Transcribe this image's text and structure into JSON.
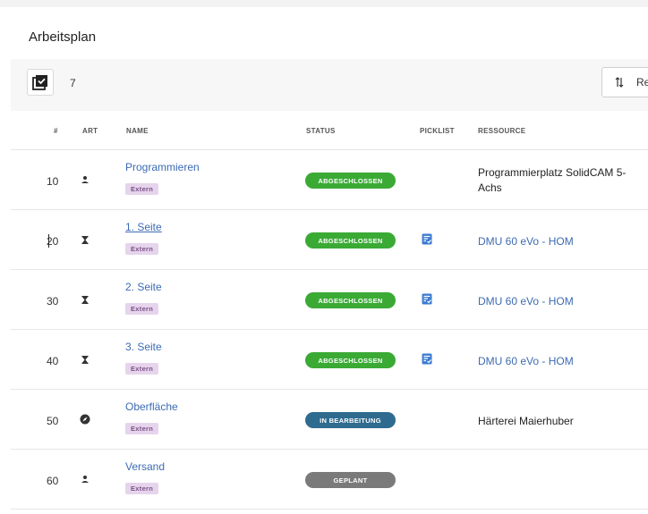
{
  "panel": {
    "title": "Arbeitsplan"
  },
  "toolbar": {
    "selected_count": "7",
    "sort_label": "Re"
  },
  "table": {
    "headers": [
      "#",
      "ART",
      "NAME",
      "STATUS",
      "PICKLIST",
      "RESSOURCE"
    ],
    "rows": [
      {
        "num": "10",
        "art_icon": "person-icon",
        "name": "Programmieren",
        "tag": "Extern",
        "status": "ABGESCHLOSSEN",
        "picklist": false,
        "resource": "Programmierplatz SolidCAM 5-Achs",
        "resource_link": false
      },
      {
        "num": "20",
        "art_icon": "hourglass-icon",
        "name": "1. Seite",
        "tag": "Extern",
        "status": "ABGESCHLOSSEN",
        "picklist": true,
        "resource": "DMU 60 eVo - HOM",
        "resource_link": true
      },
      {
        "num": "30",
        "art_icon": "hourglass-icon",
        "name": "2. Seite",
        "tag": "Extern",
        "status": "ABGESCHLOSSEN",
        "picklist": true,
        "resource": "DMU 60 eVo - HOM",
        "resource_link": true
      },
      {
        "num": "40",
        "art_icon": "hourglass-icon",
        "name": "3. Seite",
        "tag": "Extern",
        "status": "ABGESCHLOSSEN",
        "picklist": true,
        "resource": "DMU 60 eVo - HOM",
        "resource_link": true
      },
      {
        "num": "50",
        "art_icon": "compass-icon",
        "name": "Oberfläche",
        "tag": "Extern",
        "status": "IN BEARBEITUNG",
        "picklist": false,
        "resource": "Härterei Maierhuber",
        "resource_link": false
      },
      {
        "num": "60",
        "art_icon": "person-icon",
        "name": "Versand",
        "tag": "Extern",
        "status": "GEPLANT",
        "picklist": false,
        "resource": "",
        "resource_link": false
      }
    ]
  },
  "colors": {
    "status_done": "#3aaa35",
    "status_in_progress": "#2e6b8e",
    "status_planned": "#7a7a7a",
    "link": "#3d6bb3",
    "tag_bg": "#e6d4ec",
    "tag_text": "#7a5187",
    "picklist_icon": "#3d7bd1"
  }
}
